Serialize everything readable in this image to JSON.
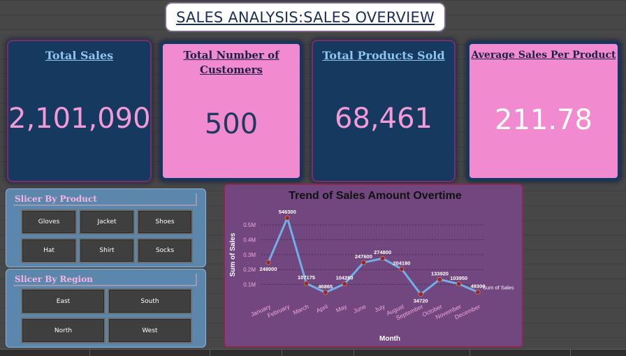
{
  "header": {
    "title": "SALES ANALYSIS:SALES OVERVIEW"
  },
  "kpis": [
    {
      "title": "Total Sales",
      "value": "2,101,090"
    },
    {
      "title": "Total Number of Customers",
      "value": "500"
    },
    {
      "title": "Total Products Sold",
      "value": "68,461"
    },
    {
      "title": "Average Sales Per Product",
      "value": "211.78"
    }
  ],
  "slicers": {
    "product": {
      "title": "Slicer By Product",
      "items": [
        "Gloves",
        "Jacket",
        "Shoes",
        "Hat",
        "Shirt",
        "Socks"
      ]
    },
    "region": {
      "title": "Slicer By Region",
      "items": [
        "East",
        "South",
        "North",
        "West"
      ]
    }
  },
  "colors": {
    "kpi_dark_bg": "#163a5f",
    "kpi_pink_bg": "#f28ad0",
    "chart_bg": "#72467e",
    "line": "#6fb0e8",
    "marker": "#8b2b2b"
  },
  "chart_data": {
    "type": "line",
    "title": "Trend of Sales Amount Overtime",
    "xlabel": "Month",
    "ylabel": "Sum of Sales",
    "categories": [
      "January",
      "February",
      "March",
      "April",
      "May",
      "June",
      "July",
      "August",
      "September",
      "October",
      "November",
      "December"
    ],
    "series": [
      {
        "name": "Sum of Sales",
        "values": [
          248000,
          546300,
          107175,
          46865,
          104280,
          247600,
          274800,
          204180,
          34720,
          133920,
          103950,
          49300
        ]
      }
    ],
    "data_labels": [
      "248000",
      "546300",
      "107175",
      "46865",
      "104280",
      "247600",
      "274800",
      "204180",
      "34720",
      "133920",
      "103950",
      "49300"
    ],
    "y_ticks": [
      100000,
      200000,
      300000,
      400000,
      500000
    ],
    "y_tick_labels": [
      "0.1M",
      "0.2M",
      "0.3M",
      "0.4M",
      "0.5M"
    ],
    "ylim": [
      0,
      580000
    ],
    "grid": true,
    "legend": "right"
  }
}
